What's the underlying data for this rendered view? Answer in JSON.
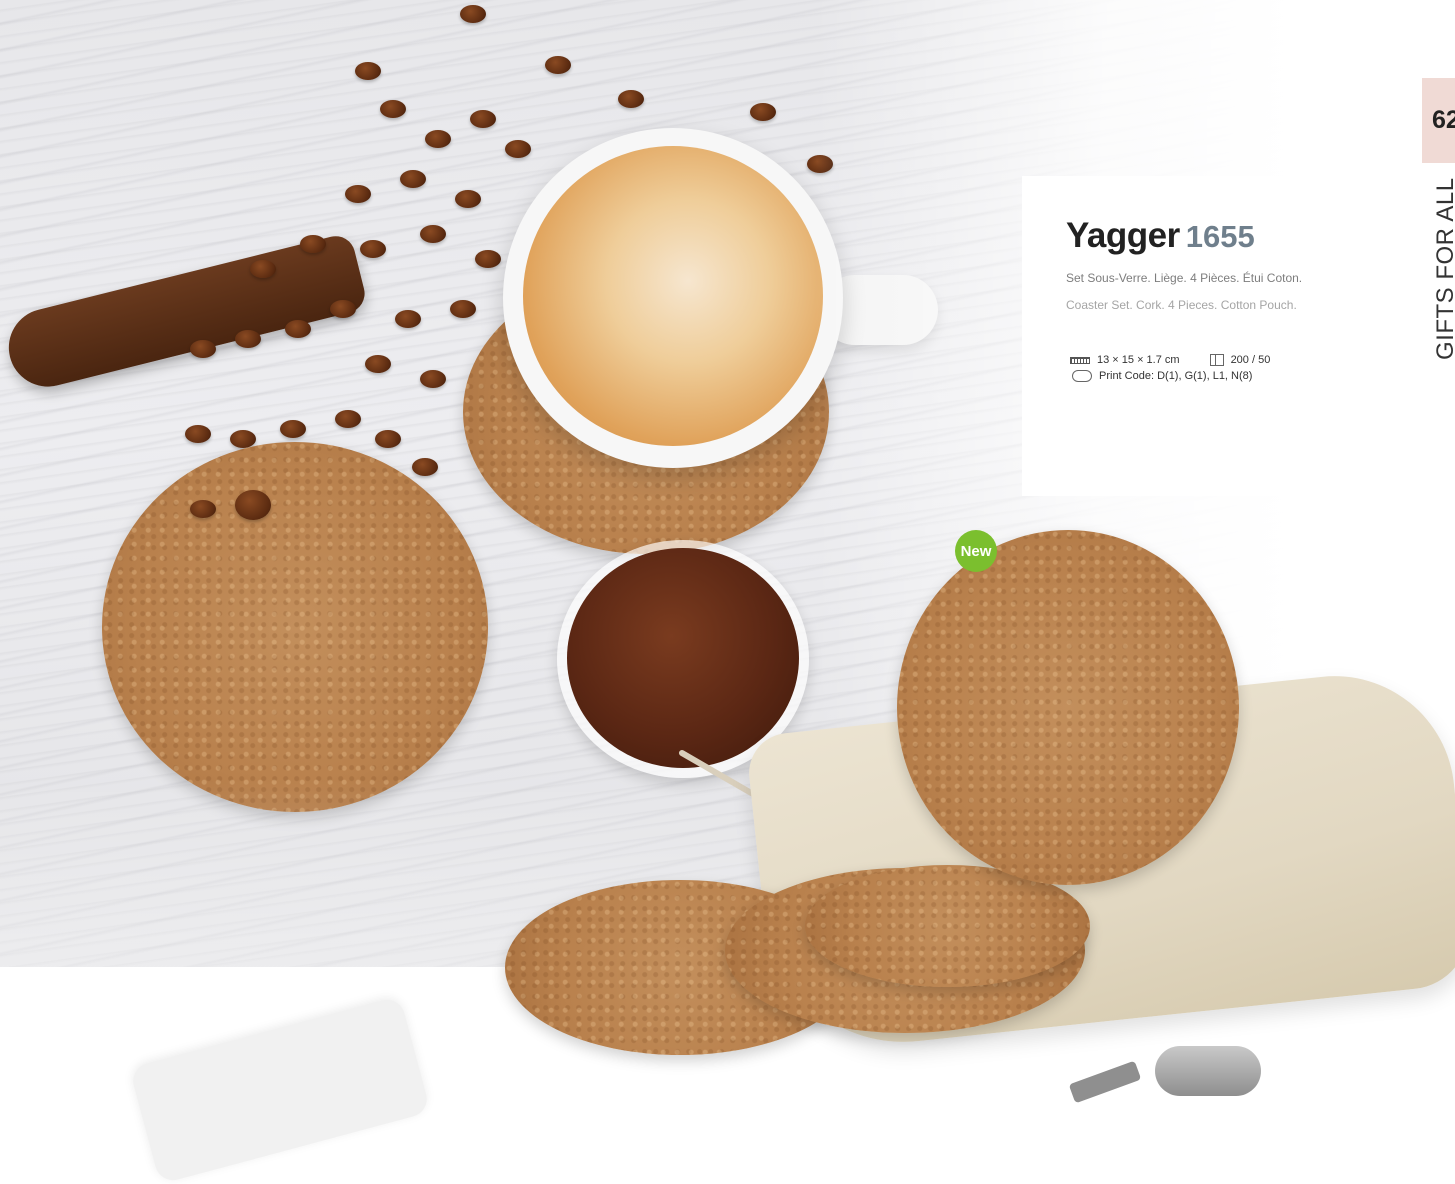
{
  "product": {
    "name": "Yagger",
    "code": "1655",
    "description_fr": "Set Sous-Verre. Liège. 4 Pièces. Étui Coton.",
    "description_en": "Coaster Set. Cork. 4 Pieces. Cotton Pouch.",
    "dimensions": "13 × 15 × 1.7 cm",
    "packaging": "200 / 50",
    "print_code": "Print Code: D(1), G(1), L1, N(8)",
    "badge": "New"
  },
  "page": {
    "number": "62",
    "section": "GIFTS FOR ALL"
  },
  "colors": {
    "badge_green": "#7bbf2e",
    "tab_pink": "#f0dad5",
    "code_gray": "#6f7f8c"
  },
  "icons": {
    "dimensions": "ruler-icon",
    "packaging": "box-icon",
    "print": "print-method-icon"
  }
}
